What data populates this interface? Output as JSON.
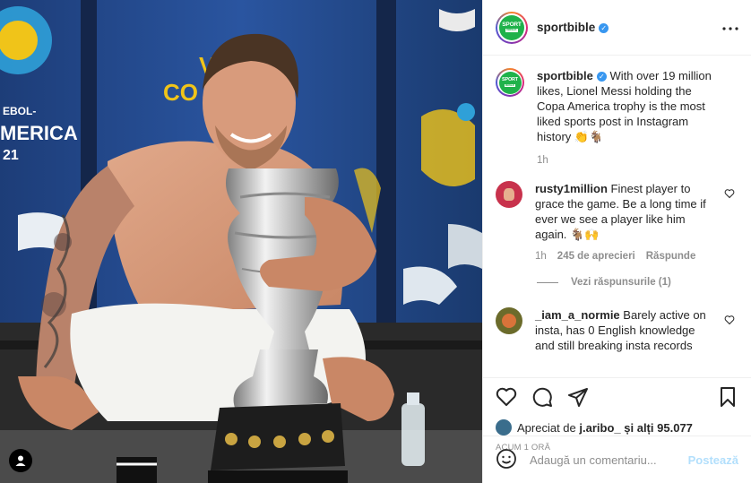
{
  "post": {
    "username": "sportbible",
    "verified": true,
    "more_icon": "more-horizontal-icon"
  },
  "photo": {
    "banner_text_1": "VA",
    "banner_text_2": "CO  ATE.",
    "side_text_1": "EBOL-",
    "side_text_2": "MERICA",
    "side_text_3": "21"
  },
  "caption": {
    "username": "sportbible",
    "text": "With over 19 million likes, Lionel Messi holding the Copa America trophy is the most liked sports post in Instagram history",
    "emojis": "👏🐐",
    "time": "1h"
  },
  "comments": [
    {
      "username": "rusty1million",
      "text": "Finest player to grace the game. Be a long time if ever we see a player like him again.",
      "emojis": "🐐🙌",
      "time": "1h",
      "likes": "245 de aprecieri",
      "reply": "Răspunde",
      "view_replies": "Vezi răspunsurile (1)"
    },
    {
      "username": "_iam_a_normie",
      "text": "Barely active on insta, has 0 English knowledge and still breaking insta records"
    }
  ],
  "actions": {
    "liked_by_prefix": "Apreciat de",
    "liked_by_user": "j.aribo_",
    "liked_by_mid": "și alți",
    "liked_by_count": "95.077",
    "timestamp": "ACUM 1 ORĂ"
  },
  "add_comment": {
    "placeholder": "Adaugă un comentariu...",
    "post_label": "Postează"
  },
  "colors": {
    "brand_green": "#1fb24a",
    "verified_blue": "#3897f0",
    "post_disabled": "#b2dffc"
  }
}
